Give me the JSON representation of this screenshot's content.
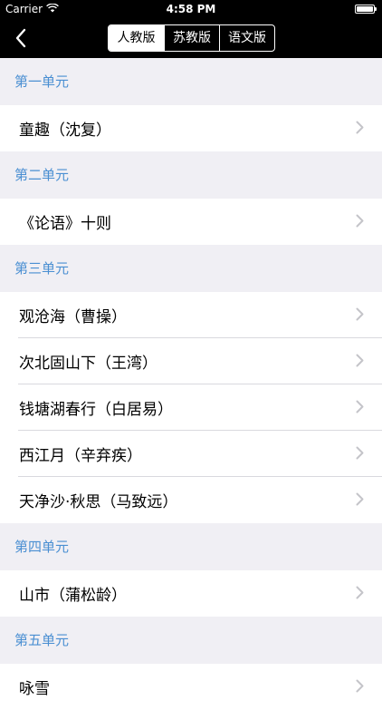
{
  "status_bar": {
    "carrier": "Carrier",
    "time": "4:58 PM"
  },
  "nav": {
    "segments": [
      {
        "label": "人教版",
        "active": true
      },
      {
        "label": "苏教版",
        "active": false
      },
      {
        "label": "语文版",
        "active": false
      }
    ]
  },
  "sections": [
    {
      "title": "第一单元",
      "items": [
        "童趣（沈复）"
      ]
    },
    {
      "title": "第二单元",
      "items": [
        "《论语》十则"
      ]
    },
    {
      "title": "第三单元",
      "items": [
        "观沧海（曹操）",
        "次北固山下（王湾）",
        "钱塘湖春行（白居易）",
        "西江月（辛弃疾）",
        "天净沙·秋思（马致远）"
      ]
    },
    {
      "title": "第四单元",
      "items": [
        "山市（蒲松龄）"
      ]
    },
    {
      "title": "第五单元",
      "items": [
        "咏雪"
      ]
    }
  ],
  "colors": {
    "section_title": "#4a8fd2",
    "nav_bg": "#000000",
    "list_bg": "#f0eff4"
  }
}
